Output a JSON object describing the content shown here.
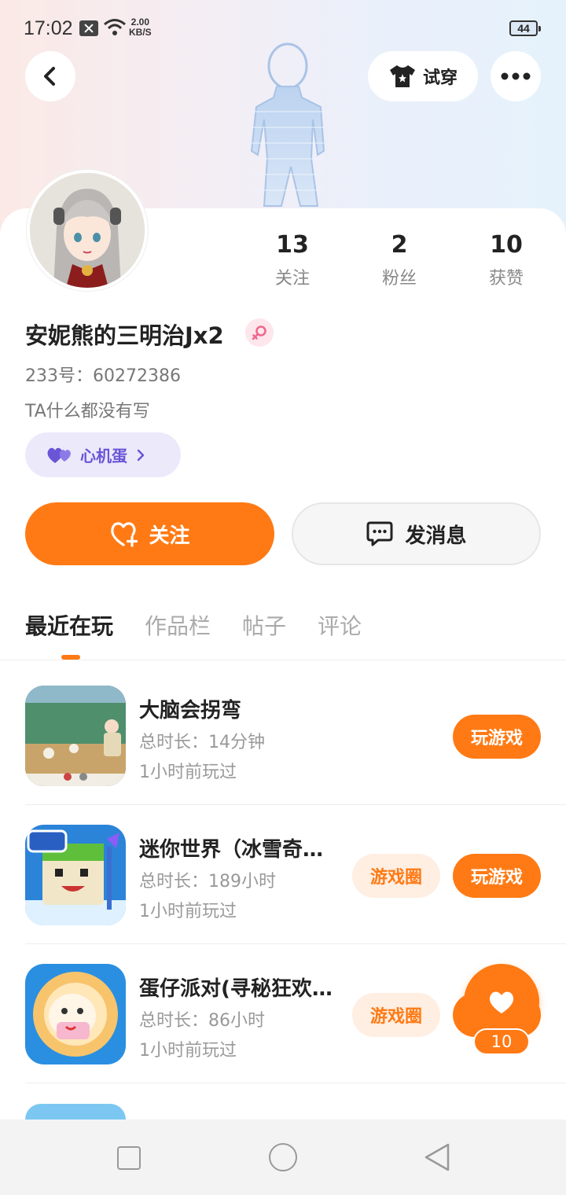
{
  "status_bar": {
    "time": "17:02",
    "net_speed_value": "2.00",
    "net_speed_unit": "KB/S",
    "battery": "44"
  },
  "header": {
    "tryon_label": "试穿"
  },
  "profile": {
    "stats": [
      {
        "count": "13",
        "label": "关注"
      },
      {
        "count": "2",
        "label": "粉丝"
      },
      {
        "count": "10",
        "label": "获赞"
      }
    ],
    "username": "安妮熊的三明治Jx2",
    "uid_line": "233号：60272386",
    "bio": "TA什么都没有写",
    "heart_chip_label": "心机蛋"
  },
  "actions": {
    "follow_label": "关注",
    "message_label": "发消息"
  },
  "tabs": [
    {
      "label": "最近在玩",
      "active": true
    },
    {
      "label": "作品栏",
      "active": false
    },
    {
      "label": "帖子",
      "active": false
    },
    {
      "label": "评论",
      "active": false
    }
  ],
  "games": [
    {
      "title": "大脑会拐弯",
      "duration": "总时长：14分钟",
      "last_played": "1小时前玩过",
      "play_label": "玩游戏"
    },
    {
      "title": "迷你世界（冰雪奇…",
      "duration": "总时长：189小时",
      "last_played": "1小时前玩过",
      "circle_label": "游戏圈",
      "play_label": "玩游戏"
    },
    {
      "title": "蛋仔派对(寻秘狂欢…",
      "duration": "总时长：86小时",
      "last_played": "1小时前玩过",
      "circle_label": "游戏圈"
    }
  ],
  "float_like": {
    "count": "10"
  },
  "colors": {
    "accent": "#ff7a14",
    "accent_light": "#ffeee2",
    "chip_purple": "#6a55d6"
  }
}
